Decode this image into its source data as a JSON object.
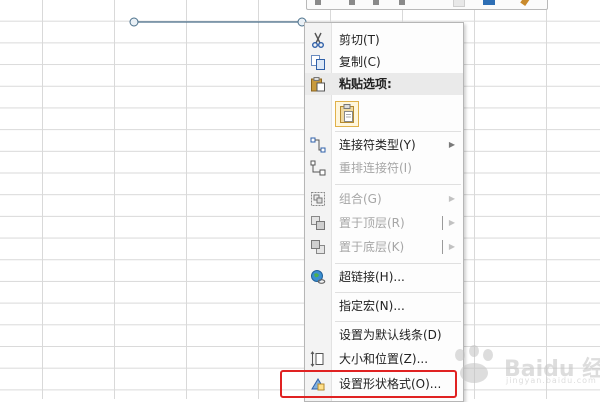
{
  "menu": {
    "cut": "剪切(T)",
    "copy": "复制(C)",
    "paste_options": "粘贴选项:",
    "connector_type": "连接符类型(Y)",
    "reroute": "重排连接符(I)",
    "group": "组合(G)",
    "bring_front": "置于顶层(R)",
    "send_back": "置于底层(K)",
    "hyperlink": "超链接(H)...",
    "assign_macro": "指定宏(N)...",
    "set_default_line": "设置为默认线条(D)",
    "size_position": "大小和位置(Z)...",
    "format_shape": "设置形状格式(O)..."
  },
  "watermark": {
    "text": "Baidu 经验",
    "sub": "jingyan.baidu.com"
  },
  "colors": {
    "highlight": "#e02222",
    "connector": "#4a6f8a"
  }
}
